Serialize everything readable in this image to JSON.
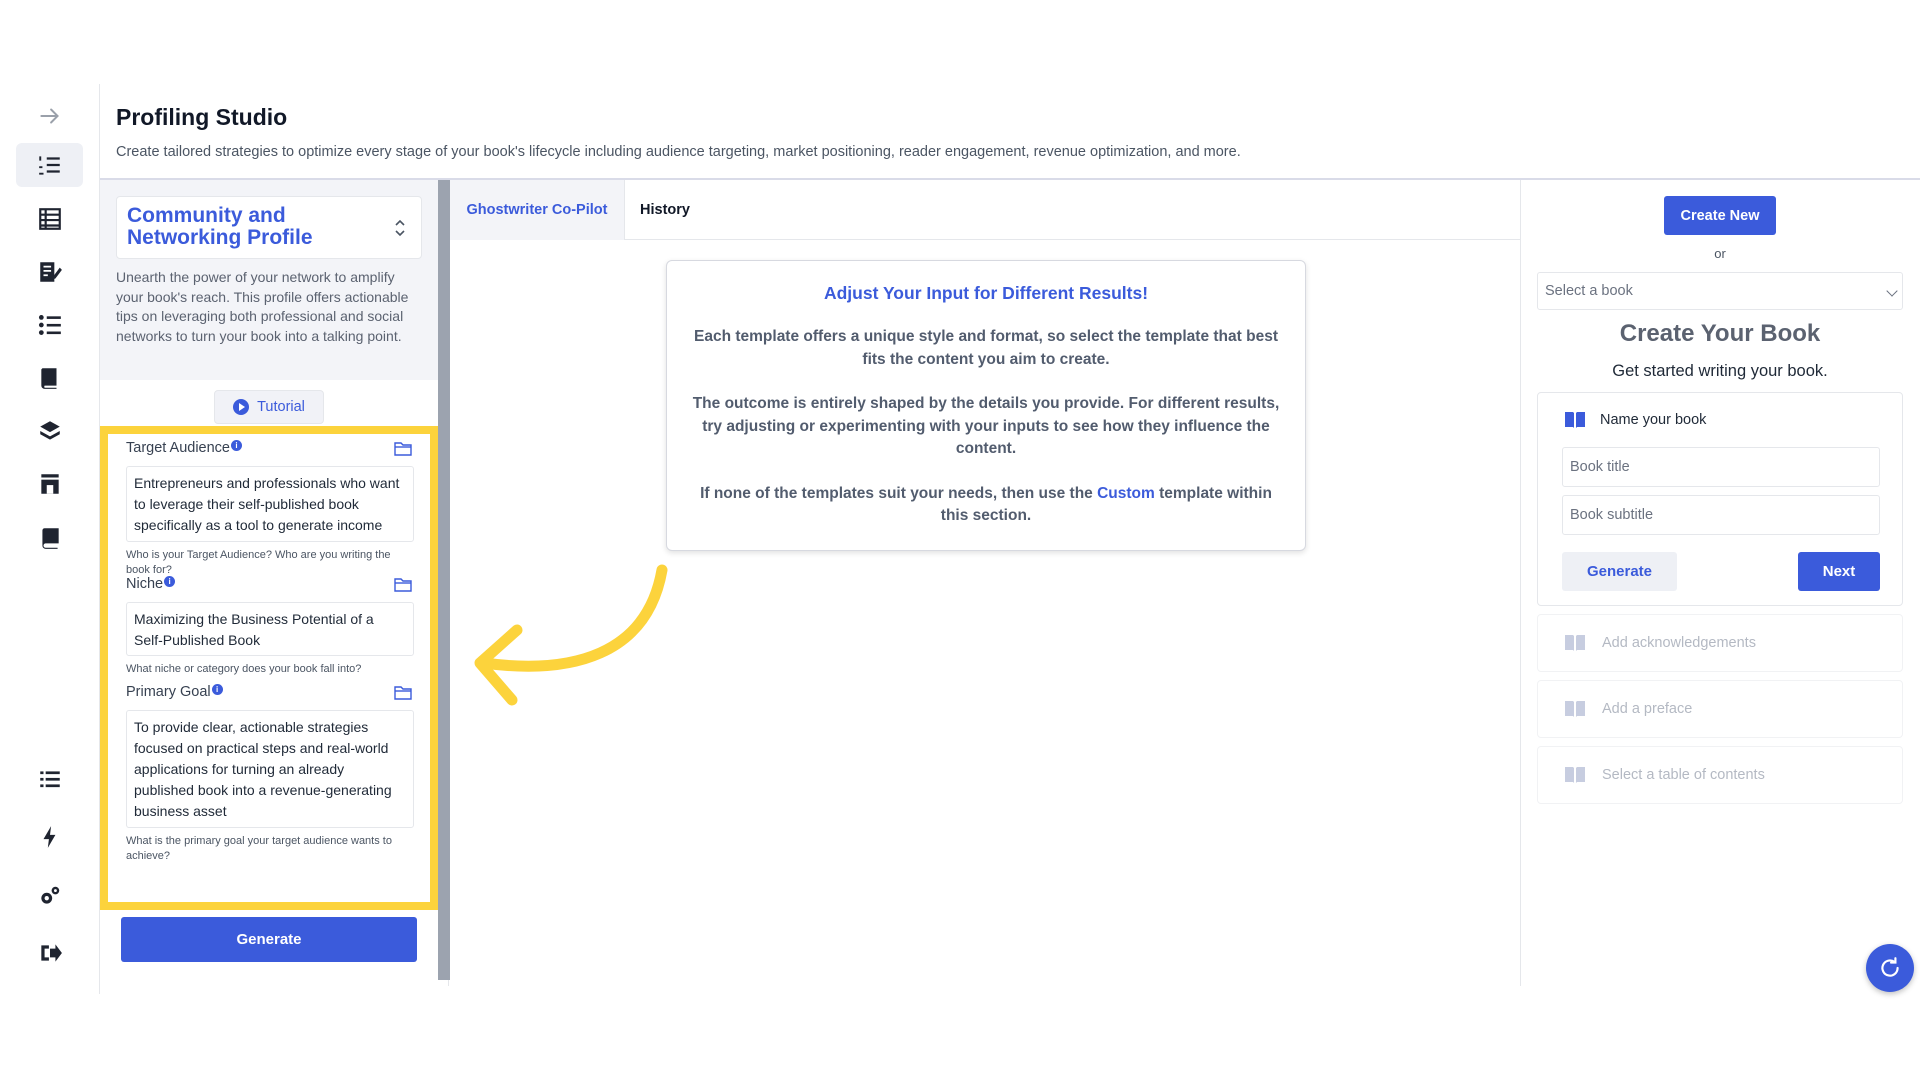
{
  "header": {
    "title": "Profiling Studio",
    "description": "Create tailored strategies to optimize every stage of your book's lifecycle including audience targeting, market positioning, reader engagement, revenue optimization, and more."
  },
  "sidebar": {
    "items": [
      {
        "icon": "arrow-right-icon"
      },
      {
        "icon": "numbered-list-icon",
        "active": true
      },
      {
        "icon": "table-icon"
      },
      {
        "icon": "edit-document-icon"
      },
      {
        "icon": "list-icon"
      },
      {
        "icon": "book-stack-icon"
      },
      {
        "icon": "books-icon"
      },
      {
        "icon": "shop-icon"
      },
      {
        "icon": "book-icon"
      },
      {
        "icon": "list-bullets-icon"
      },
      {
        "icon": "lightning-icon"
      },
      {
        "icon": "gears-icon"
      },
      {
        "icon": "logout-icon"
      }
    ]
  },
  "profile": {
    "name": "Community and Networking Profile",
    "description": "Unearth the power of your network to amplify your book's reach. This profile offers actionable tips on leveraging both professional and social networks to turn your book into a talking point.",
    "tutorial_label": "Tutorial"
  },
  "fields": {
    "target_audience": {
      "label": "Target Audience",
      "value": "Entrepreneurs and professionals who want to leverage their self-published book specifically as a tool to generate income streams and create business",
      "help": "Who is your Target Audience? Who are you writing the book for?"
    },
    "niche": {
      "label": "Niche",
      "value": "Maximizing the Business Potential of a Self-Published Book",
      "help": "What niche or category does your book fall into?"
    },
    "primary_goal": {
      "label": "Primary Goal",
      "value": "To provide clear, actionable strategies focused on practical steps and real-world applications for turning an already published book into a revenue-generating business asset",
      "help": "What is the primary goal your target audience wants to achieve?"
    },
    "info_glyph": "i"
  },
  "generate_label": "Generate",
  "tabs": [
    {
      "label": "Ghostwriter Co-Pilot",
      "active": true
    },
    {
      "label": "History"
    }
  ],
  "info_card": {
    "title": "Adjust Your Input for Different Results!",
    "p1": "Each template offers a unique style and format, so select the template that best fits the content you aim to create.",
    "p2": "The outcome is entirely shaped by the details you provide. For different results, try adjusting or experimenting with your inputs to see how they influence the content.",
    "p3_before": "If none of the templates suit your needs, then use the ",
    "p3_highlight": "Custom",
    "p3_after": " template within this section."
  },
  "book_panel": {
    "create_new_label": "Create New",
    "or_label": "or",
    "select_placeholder": "Select a book",
    "title": "Create Your Book",
    "subtitle": "Get started writing your book.",
    "step_name": "Name your book",
    "book_title_placeholder": "Book title",
    "book_subtitle_placeholder": "Book subtitle",
    "generate_label": "Generate",
    "next_label": "Next",
    "steps": [
      "Add acknowledgements",
      "Add a preface",
      "Select a table of contents"
    ]
  },
  "colors": {
    "accent": "#3b5bdb",
    "highlight": "#fcd33c",
    "muted": "#b4b9c3"
  }
}
